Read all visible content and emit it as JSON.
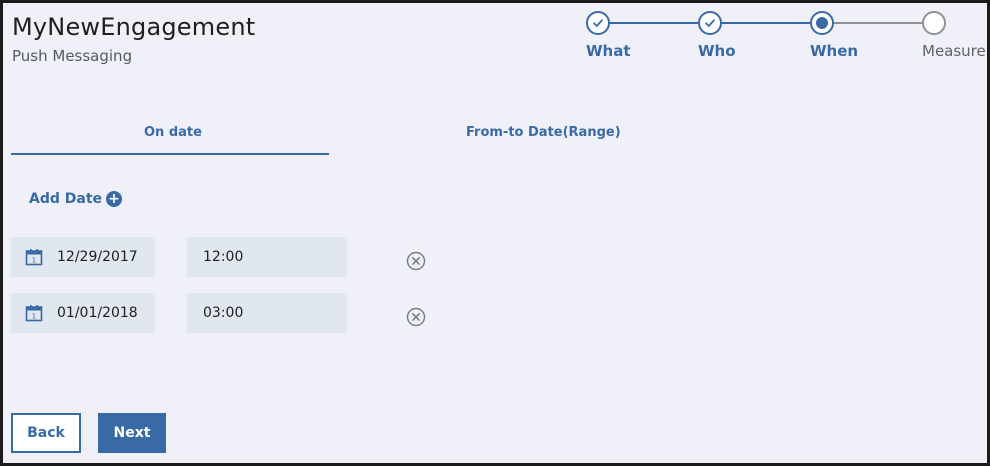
{
  "header": {
    "title": "MyNewEngagement",
    "subtitle": "Push Messaging"
  },
  "progress": {
    "steps": [
      {
        "label": "What",
        "state": "complete"
      },
      {
        "label": "Who",
        "state": "complete"
      },
      {
        "label": "When",
        "state": "current"
      },
      {
        "label": "Measure",
        "state": "pending"
      }
    ]
  },
  "tabs": {
    "on_date": "On date",
    "range": "From-to Date(Range)",
    "active": "On date"
  },
  "add_date_label": "Add Date",
  "entries": [
    {
      "date": "12/29/2017",
      "time": "12:00"
    },
    {
      "date": "01/01/2018",
      "time": "03:00"
    }
  ],
  "buttons": {
    "back": "Back",
    "next": "Next"
  },
  "colors": {
    "accent": "#3a6aa6",
    "background": "#f0f1f8",
    "field": "#e0e7ee",
    "inactive": "#8e9298"
  },
  "icons": {
    "complete_step": "check-icon",
    "current_step": "dot-icon",
    "add": "plus-circle-icon",
    "date": "calendar-icon",
    "remove": "close-circle-icon"
  }
}
